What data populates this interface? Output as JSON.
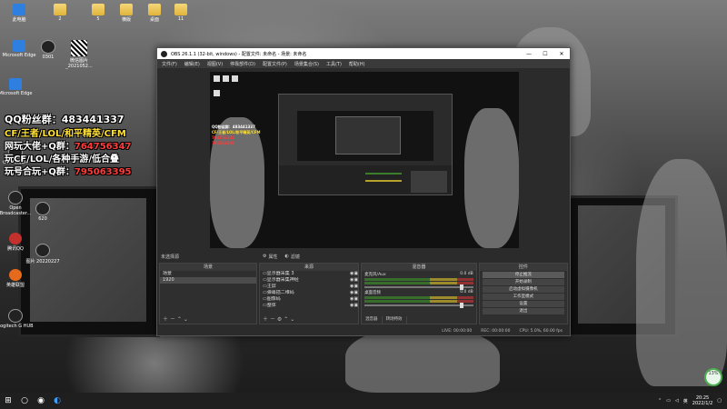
{
  "desktop": {
    "icons_top": [
      {
        "label": "此电脑",
        "icon": "computer-icon"
      },
      {
        "label": "2",
        "icon": "folder-icon"
      },
      {
        "label": "5",
        "icon": "folder-icon"
      },
      {
        "label": "横版",
        "icon": "folder-icon"
      },
      {
        "label": "桌面",
        "icon": "folder-icon"
      },
      {
        "label": "11",
        "icon": "folder-icon"
      }
    ],
    "icons_row2": [
      {
        "label": "Microsoft Edge",
        "icon": "edge-icon"
      },
      {
        "label": "0301",
        "icon": "file-icon"
      },
      {
        "label": "微信图片_2021052...",
        "icon": "qr-image-icon"
      }
    ],
    "icons_left": [
      {
        "label": "Microsoft Edge",
        "icon": "edge-icon"
      },
      {
        "label": "OBS Studio",
        "icon": "obs-icon"
      },
      {
        "label": "Open Broadcaster...",
        "icon": "obs-icon"
      },
      {
        "label": "腾讯QQ",
        "icon": "qq-icon"
      },
      {
        "label": "英雄联盟",
        "icon": "lol-icon"
      },
      {
        "label": "Logitech G HUB",
        "icon": "logitech-icon"
      }
    ],
    "icons_left2": [
      {
        "label": "620"
      },
      {
        "label": "图片 20220227"
      }
    ]
  },
  "promo": {
    "line1": "QQ粉丝群：483441337",
    "line2": "CF/王者/LOL/和平精英/CFM",
    "line3_prefix": "网玩大佬+Q群：",
    "line3_number": "764756347",
    "line4": "玩CF/LOL/各种手游/低合叠",
    "line5_prefix": "玩号合玩+Q群：",
    "line5_number": "795063395",
    "colors": {
      "yellow": "#ffe033",
      "red": "#ff3b3b",
      "white": "#ffffff"
    }
  },
  "obs": {
    "title": "OBS 26.1.1 (32-bit, windows) - 配置文件: 未命名 - 场景: 未命名",
    "menu": [
      "文件(F)",
      "编辑(E)",
      "视图(V)",
      "停靠部件(D)",
      "配置文件(P)",
      "场景集合(S)",
      "工具(T)",
      "帮助(H)"
    ],
    "no_source_label": "未选择源",
    "properties_label": "属性",
    "filters_label": "滤镜",
    "scenes": {
      "header": "场景",
      "items": [
        "场景",
        "1920"
      ]
    },
    "sources": {
      "header": "来源",
      "items": [
        "显示器采集 3",
        "显示器采集神经",
        "主屏",
        "弹幕插二维码",
        "图像码",
        "整体"
      ]
    },
    "mixer": {
      "header": "混音器",
      "channels": [
        {
          "name": "麦克风/Aux",
          "value": "0.0 dB"
        },
        {
          "name": "桌面音频",
          "value": "0.0 dB"
        }
      ],
      "tabs": [
        "混音器",
        "转场特效"
      ]
    },
    "controls": {
      "header": "控件",
      "buttons": [
        "停止推流",
        "开始录制",
        "启动虚拟摄像机",
        "工作室模式",
        "设置",
        "退出"
      ]
    },
    "status": [
      "LIVE: 00:00:00",
      "REC: 00:00:00",
      "CPU: 5.0%, 60.00 fps"
    ]
  },
  "taskbar": {
    "time": "20:25",
    "date": "2022/1/2",
    "lang": "英",
    "perf_badge": "13%"
  }
}
